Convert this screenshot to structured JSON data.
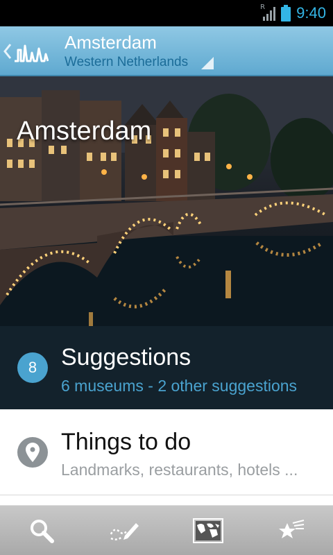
{
  "status_bar": {
    "time": "9:40",
    "roaming": "R",
    "icons": [
      "signal-icon",
      "battery-icon"
    ]
  },
  "action_bar": {
    "title": "Amsterdam",
    "subtitle": "Western Netherlands",
    "icons": [
      "back-chevron-icon",
      "city-skyline-logo-icon",
      "dropdown-triangle-icon"
    ]
  },
  "hero": {
    "title": "Amsterdam"
  },
  "suggestions": {
    "count": "8",
    "title": "Suggestions",
    "subtitle": "6 museums - 2 other suggestions"
  },
  "things_to_do": {
    "title": "Things to do",
    "subtitle": "Landmarks, restaurants, hotels ...",
    "icon": "map-pin-icon"
  },
  "bottom_nav": {
    "items": [
      {
        "icon": "search-icon"
      },
      {
        "icon": "pencil-route-icon"
      },
      {
        "icon": "world-map-icon"
      },
      {
        "icon": "star-favorites-icon"
      }
    ]
  },
  "colors": {
    "accent": "#33b5e5",
    "action_bar": "#6fb6da",
    "suggestions_bg": "#13222c",
    "suggestion_accent": "#4aa3cf"
  }
}
